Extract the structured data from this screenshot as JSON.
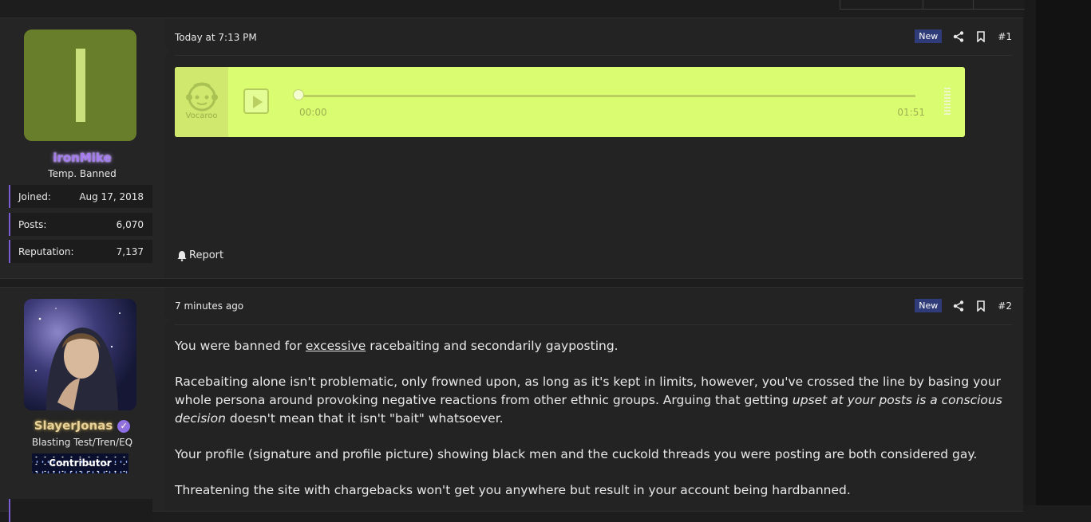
{
  "posts": [
    {
      "author": "ironMike",
      "avatar_letter": "I",
      "user_title": "Temp. Banned",
      "stats": [
        {
          "label": "Joined:",
          "value": "Aug 17, 2018"
        },
        {
          "label": "Posts:",
          "value": "6,070"
        },
        {
          "label": "Reputation:",
          "value": "7,137"
        }
      ],
      "date": "Today at 7:13 PM",
      "badge": "New",
      "number": "#1",
      "player": {
        "brand": "Vocaroo",
        "current_time": "00:00",
        "duration": "01:51",
        "progress": 0
      },
      "report_label": "Report"
    },
    {
      "author": "SlayerJonas",
      "user_title": "Blasting Test/Tren/EQ",
      "user_badge": "Contributor",
      "date": "7 minutes ago",
      "badge": "New",
      "number": "#2",
      "p1_a": "You were banned for ",
      "p1_u": "excessive",
      "p1_b": " racebaiting and secondarily gayposting.",
      "p2_a": "Racebaiting alone isn't problematic, only frowned upon, as long as it's kept in limits, however, you've crossed the line by basing your whole persona around provoking negative reactions from other ethnic groups. Arguing that getting ",
      "p2_i": "upset at your posts is a conscious decision",
      "p2_b": " doesn't mean that it isn't \"bait\" whatsoever.",
      "p3": "Your profile (signature and profile picture) showing black men and the cuckold threads you were posting are both considered gay.",
      "p4": "Threatening the site with chargebacks won't get you anywhere but result in your account being hardbanned."
    }
  ],
  "colors": {
    "accent_purple": "#7a5cd4",
    "new_badge": "#303c7a",
    "player_bg": "#d9fc71",
    "avatar_bg": "#697e2a"
  }
}
